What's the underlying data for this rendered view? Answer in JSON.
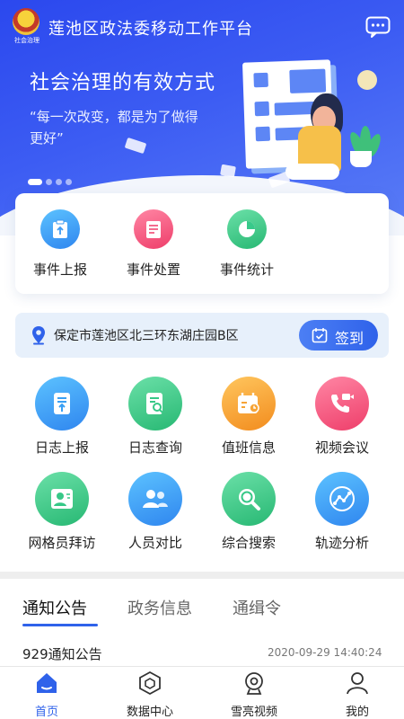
{
  "header": {
    "logo_text": "社会治理",
    "title": "莲池区政法委移动工作平台",
    "message_icon": "chat-bubble-icon"
  },
  "banner": {
    "slogan": "社会治理的有效方式",
    "quote": "“每一次改变，都是为了做得更好”",
    "slide_count": 4,
    "active_slide": 1
  },
  "events": [
    {
      "label": "事件上报",
      "icon": "clipboard-upload-icon",
      "color": "#3f9bf2"
    },
    {
      "label": "事件处置",
      "icon": "document-process-icon",
      "color": "#f2577e"
    },
    {
      "label": "事件统计",
      "icon": "pie-chart-icon",
      "color": "#38c98a"
    }
  ],
  "location": {
    "address": "保定市莲池区北三环东湖庄园B区",
    "checkin_label": "签到"
  },
  "grid": [
    {
      "label": "日志上报",
      "icon": "log-upload-icon",
      "color": "#3aa0f4"
    },
    {
      "label": "日志查询",
      "icon": "log-search-icon",
      "color": "#36c887"
    },
    {
      "label": "值班信息",
      "icon": "duty-calendar-icon",
      "color": "#f6a437"
    },
    {
      "label": "视频会议",
      "icon": "video-call-icon",
      "color": "#f2577e"
    },
    {
      "label": "网格员拜访",
      "icon": "visitor-card-icon",
      "color": "#36c887"
    },
    {
      "label": "人员对比",
      "icon": "people-compare-icon",
      "color": "#3aa0f4"
    },
    {
      "label": "综合搜索",
      "icon": "search-icon",
      "color": "#36c887"
    },
    {
      "label": "轨迹分析",
      "icon": "trajectory-icon",
      "color": "#3aa0f4"
    }
  ],
  "tabs": [
    {
      "label": "通知公告",
      "active": true
    },
    {
      "label": "政务信息",
      "active": false
    },
    {
      "label": "通缉令",
      "active": false
    }
  ],
  "notice": {
    "title": "929通知公告",
    "time": "2020-09-29  14:40:24"
  },
  "bottom_nav": [
    {
      "label": "首页",
      "icon": "home-icon",
      "active": true
    },
    {
      "label": "数据中心",
      "icon": "data-cube-icon",
      "active": false
    },
    {
      "label": "雪亮视频",
      "icon": "camera-icon",
      "active": false
    },
    {
      "label": "我的",
      "icon": "user-icon",
      "active": false
    }
  ],
  "colors": {
    "primary": "#2f62ea",
    "banner": "#3c5cf3",
    "location_bg": "#e7f0fb"
  }
}
